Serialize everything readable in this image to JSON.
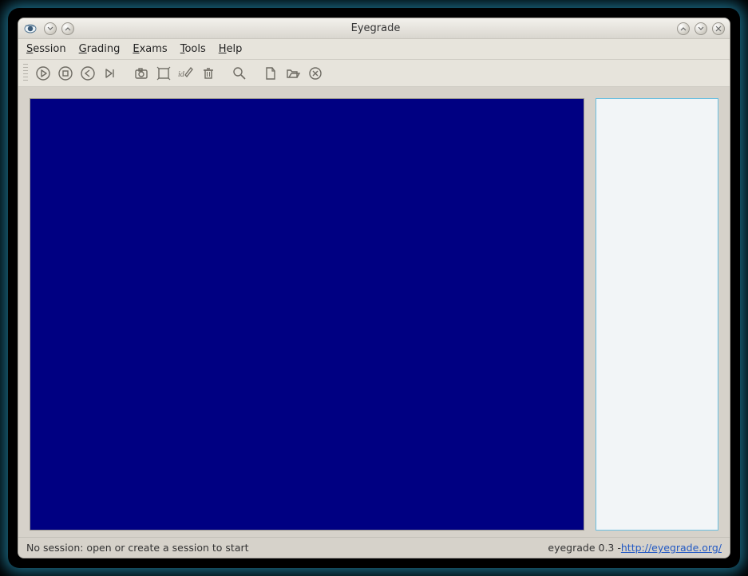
{
  "window": {
    "title": "Eyegrade"
  },
  "menu": {
    "session": "Session",
    "grading": "Grading",
    "exams": "Exams",
    "tools": "Tools",
    "help": "Help"
  },
  "status": {
    "left": "No session: open or create a session to start",
    "right_prefix": "eyegrade 0.3 - ",
    "link_text": "http://eyegrade.org/"
  }
}
